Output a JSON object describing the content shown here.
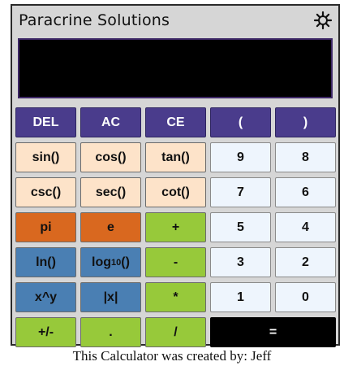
{
  "app": {
    "title": "Paracrine Solutions",
    "settings_icon": "gear-icon"
  },
  "display": {
    "value": ""
  },
  "buttons": {
    "del": "DEL",
    "ac": "AC",
    "ce": "CE",
    "lparen": "(",
    "rparen": ")",
    "sin": "sin()",
    "cos": "cos()",
    "tan": "tan()",
    "nine": "9",
    "eight": "8",
    "csc": "csc()",
    "sec": "sec()",
    "cot": "cot()",
    "seven": "7",
    "six": "6",
    "pi": "pi",
    "e": "e",
    "plus": "+",
    "five": "5",
    "four": "4",
    "ln": "ln()",
    "log_prefix": "log",
    "log_base": "10",
    "log_suffix": "()",
    "minus": "-",
    "three": "3",
    "two": "2",
    "pow": "x^y",
    "abs": "|x|",
    "multiply": "*",
    "one": "1",
    "zero": "0",
    "negate": "+/-",
    "dot": ".",
    "divide": "/",
    "equals": "="
  },
  "footer": {
    "credit": "This Calculator was created by: Jeff"
  },
  "colors": {
    "panel": "#d6d6d6",
    "purple": "#4a3c8c",
    "peach": "#fde3c9",
    "light": "#eef5fd",
    "orange": "#d9681f",
    "blue": "#4a7fb3",
    "green": "#97c93a",
    "display": "#000000"
  }
}
